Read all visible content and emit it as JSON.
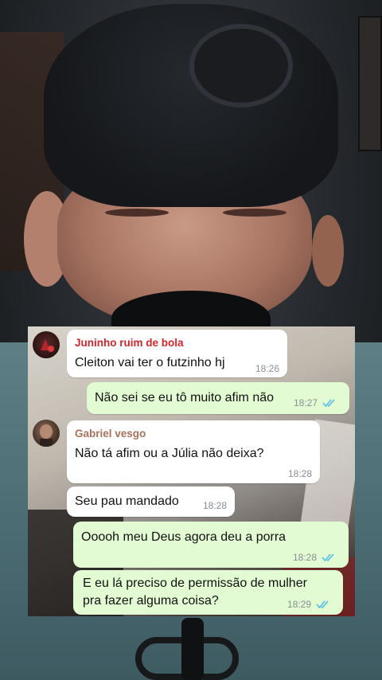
{
  "chat": {
    "messages": [
      {
        "direction": "in",
        "sender": "Juninho ruim de bola",
        "sender_color": "#d1262b",
        "text": "Cleiton vai ter o futzinho hj",
        "time": "18:26"
      },
      {
        "direction": "out",
        "text": "Não sei se eu tô muito afim não",
        "time": "18:27",
        "status": "read"
      },
      {
        "direction": "in",
        "sender": "Gabriel vesgo",
        "sender_color": "#a8715b",
        "text": "Não tá afim ou a Júlia não deixa?",
        "time": "18:28"
      },
      {
        "direction": "in",
        "text": "Seu pau mandado",
        "time": "18:28"
      },
      {
        "direction": "out",
        "text": "Ooooh meu Deus agora deu a porra",
        "time": "18:28",
        "status": "read"
      },
      {
        "direction": "out",
        "text_lines": [
          "E eu lá preciso de permissão de mulher",
          "pra fazer alguma coisa?"
        ],
        "time": "18:29",
        "status": "read"
      }
    ],
    "read_tick_color": "#53bdeb",
    "icons": {
      "read_status": "double-check-icon"
    }
  }
}
